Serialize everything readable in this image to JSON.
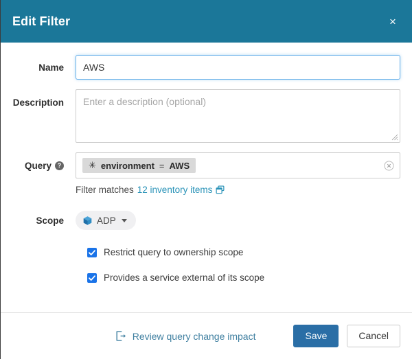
{
  "dialog": {
    "title": "Edit Filter",
    "close_label": "×",
    "close_icon": "close-icon"
  },
  "form": {
    "name": {
      "label": "Name",
      "value": "AWS",
      "placeholder": ""
    },
    "description": {
      "label": "Description",
      "value": "",
      "placeholder": "Enter a description (optional)"
    },
    "query": {
      "label": "Query",
      "help_icon": "help-circle-icon",
      "help_label": "?",
      "chip": {
        "star": "✳",
        "field": "environment",
        "operator": "=",
        "value": "AWS"
      },
      "clear_icon": "clear-circle-icon",
      "matches_prefix": "Filter matches",
      "matches_link": "12 inventory items",
      "matches_icon": "open-in-new-window-icon"
    },
    "scope": {
      "label": "Scope",
      "value": "ADP",
      "icon": "cube-icon",
      "caret_icon": "chevron-down-icon"
    },
    "checkboxes": [
      {
        "label": "Restrict query to ownership scope",
        "checked": true
      },
      {
        "label": "Provides a service external of its scope",
        "checked": true
      }
    ]
  },
  "footer": {
    "review_link": "Review query change impact",
    "review_icon": "sign-out-icon",
    "save_label": "Save",
    "cancel_label": "Cancel"
  },
  "colors": {
    "header_bg": "#1b7799",
    "link": "#2a93b8",
    "checkbox": "#1a73e8",
    "primary_button": "#2a6ea6",
    "chip_bg": "#d9d9d9",
    "focus_border": "#66afe9"
  }
}
